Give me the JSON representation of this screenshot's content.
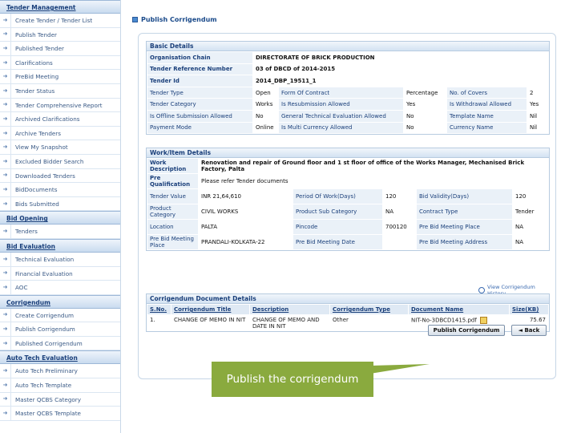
{
  "sidebar": {
    "groups": [
      {
        "title": "Tender Management",
        "items": [
          "Create Tender / Tender List",
          "Publish Tender",
          "Published Tender",
          "Clarifications",
          "PreBid Meeting",
          "Tender Status",
          "Tender Comprehensive Report",
          "Archived Clarifications",
          "Archive Tenders",
          "View My Snapshot",
          "Excluded Bidder Search",
          "Downloaded Tenders",
          "BidDocuments",
          "Bids Submitted"
        ]
      },
      {
        "title": "Bid Opening",
        "items": [
          "Tenders"
        ]
      },
      {
        "title": "Bid Evaluation",
        "items": [
          "Technical Evaluation",
          "Financial Evaluation",
          "AOC"
        ]
      },
      {
        "title": "Corrigendum",
        "items": [
          "Create Corrigendum",
          "Publish Corrigendum",
          "Published Corrigendum"
        ]
      },
      {
        "title": "Auto Tech Evaluation",
        "items": [
          "Auto Tech Preliminary",
          "Auto Tech Template",
          "Master QCBS Category",
          "Master QCBS Template"
        ]
      }
    ]
  },
  "header": {
    "title": "Publish Corrigendum"
  },
  "basic": {
    "title": "Basic Details",
    "org_label": "Organisation Chain",
    "org_value": "DIRECTORATE OF BRICK PRODUCTION",
    "ref_label": "Tender Reference Number",
    "ref_value": "03 of DBCD of 2014-2015",
    "id_label": "Tender Id",
    "id_value": "2014_DBP_19511_1",
    "rows": [
      [
        "Tender Type",
        "Open",
        "Form Of Contract",
        "Percentage",
        "No. of Covers",
        "2"
      ],
      [
        "Tender Category",
        "Works",
        "Is Resubmission Allowed",
        "Yes",
        "Is Withdrawal Allowed",
        "Yes"
      ],
      [
        "Is Offline Submission Allowed",
        "No",
        "General Technical Evaluation Allowed",
        "No",
        "Template Name",
        "Nil"
      ],
      [
        "Payment Mode",
        "Online",
        "Is Multi Currency Allowed",
        "No",
        "Currency Name",
        "Nil"
      ]
    ]
  },
  "work": {
    "title": "Work/Item Details",
    "desc_label": "Work Description",
    "desc_value": "Renovation and repair of Ground floor and 1 st floor of office of the Works Manager, Mechanised Brick Factory, Palta",
    "pq_label": "Pre Qualification",
    "pq_value": "Please refer Tender documents",
    "rows": [
      [
        "Tender Value",
        "INR 21,64,610",
        "Period Of Work(Days)",
        "120",
        "Bid Validity(Days)",
        "120"
      ],
      [
        "Product Category",
        "CIVIL WORKS",
        "Product Sub Category",
        "NA",
        "Contract Type",
        "Tender"
      ],
      [
        "Location",
        "PALTA",
        "Pincode",
        "700120",
        "Pre Bid Meeting Place",
        "NA"
      ],
      [
        "Pre Bid Meeting Place",
        "PRANDALI-KOLKATA-22",
        "Pre Bid Meeting Date",
        "",
        "Pre Bid Meeting Address",
        "NA"
      ]
    ]
  },
  "view_history": "View Corrigendum History",
  "docs": {
    "title": "Corrigendum Document Details",
    "headers": [
      "S.No.",
      "Corrigendum Title",
      "Description",
      "Corrigendum Type",
      "Document Name",
      "Size(KB)"
    ],
    "rows": [
      [
        "1.",
        "CHANGE OF MEMO IN NIT",
        "CHANGE OF MEMO AND DATE IN NIT",
        "Other",
        "NIT-No-3DBCD1415.pdf",
        "75.67"
      ]
    ]
  },
  "buttons": {
    "publish": "Publish Corrigendum",
    "back": "◄ Back"
  },
  "callout": "Publish the corrigendum",
  "colors": {
    "callout": "#8aaa3e",
    "accent": "#1a3f7a"
  }
}
